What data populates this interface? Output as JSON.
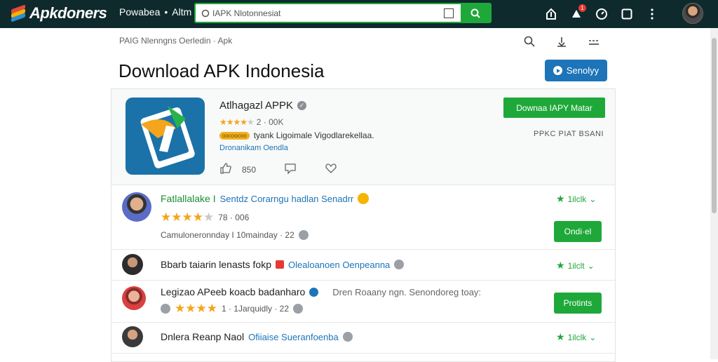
{
  "topbar": {
    "logo_text": "Apkdoners",
    "nav_left": "Powabea",
    "nav_sep": "•",
    "nav_right": "Altm",
    "search_placeholder": "IAPK Nlotonnesiat",
    "notif_count": "1"
  },
  "header": {
    "breadcrumb": "PAIG Nlenngns Oerledin · Apk",
    "title": "Download APK Indonesia",
    "subscribe_label": "Senolyy"
  },
  "featured": {
    "app_name": "Atlhagazl APPK",
    "rating_count": "2 · 00K",
    "tag_badge": "oocoocoo",
    "tag_text": "tyank Ligoimale Vigodlarekellaa.",
    "developer": "Dronanikam Oendla",
    "likes": "850",
    "download_label": "Downaa IAPY Matar",
    "size_label": "PPKC PIAT BSANI"
  },
  "rows": [
    {
      "title": "Fatlallalake I",
      "link": "Sentdz Corarngu hadlan Senadrr",
      "rating": "78 · 006",
      "meta": "Camuloneronnday I  10mainday · 22",
      "likes": "1ilclk",
      "button": "Ondi·el"
    },
    {
      "title": "Bbarb taiarin lenasts fokp",
      "link": "Olealoanoen Oenpeanna",
      "likes": "1ilclt"
    },
    {
      "title": "Legizao APeeb koacb badanharo",
      "muted": "Dren Roaany ngn. Senondoreg toay:",
      "meta_count": "1 · 1Jarquidly · 22",
      "button": "Protints"
    },
    {
      "title": "Dnlera Reanp Naol",
      "link": "Ofiiaise Sueranfoenba",
      "likes": "1ilclk"
    }
  ],
  "colors": {
    "topbar_bg": "#0f2a2c",
    "accent_green": "#1fa83a",
    "accent_blue": "#1d74b8",
    "star": "#f3a518"
  }
}
